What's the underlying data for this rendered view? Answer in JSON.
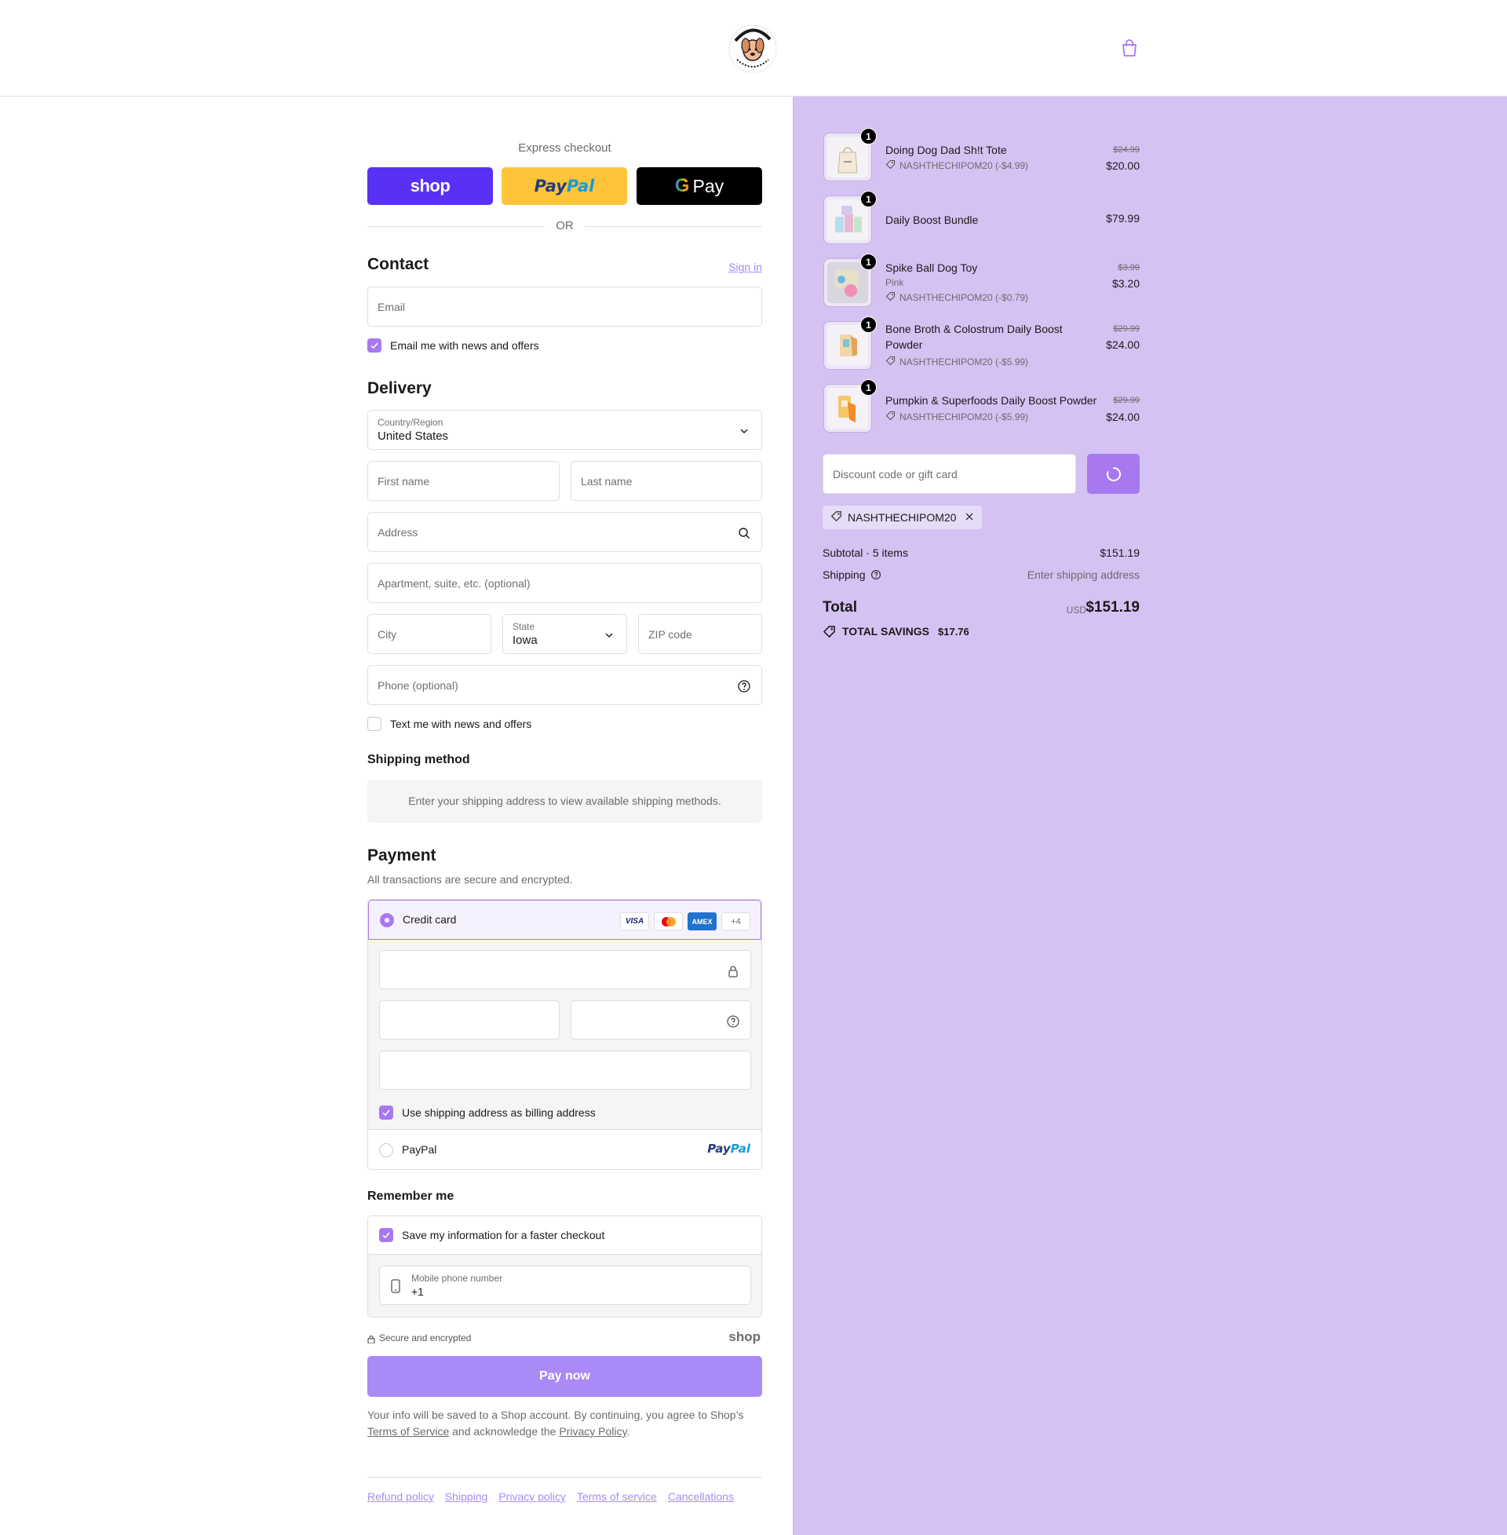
{
  "header": {
    "logo_text_top": "Bundle of Joy",
    "logo_text_bottom": "FAMILY WITH A PURPOSE",
    "cart_icon": "shopping-bag-icon"
  },
  "express": {
    "label": "Express checkout",
    "shop_label": "shop",
    "paypal_label_1": "Pay",
    "paypal_label_2": "Pal",
    "gpay_label": "Pay",
    "or_label": "OR"
  },
  "contact": {
    "title": "Contact",
    "sign_in": "Sign in",
    "email_placeholder": "Email",
    "news_label": "Email me with news and offers"
  },
  "delivery": {
    "title": "Delivery",
    "country_label": "Country/Region",
    "country_value": "United States",
    "first_name_placeholder": "First name",
    "last_name_placeholder": "Last name",
    "address_placeholder": "Address",
    "apartment_placeholder": "Apartment, suite, etc. (optional)",
    "city_placeholder": "City",
    "state_label": "State",
    "state_value": "Iowa",
    "zip_placeholder": "ZIP code",
    "phone_placeholder": "Phone (optional)",
    "text_label": "Text me with news and offers"
  },
  "shipping_method": {
    "title": "Shipping method",
    "message": "Enter your shipping address to view available shipping methods."
  },
  "payment": {
    "title": "Payment",
    "subtitle": "All transactions are secure and encrypted.",
    "credit_card_label": "Credit card",
    "card_brands": [
      "VISA",
      "mastercard",
      "AMEX",
      "+4"
    ],
    "billing_label": "Use shipping address as billing address",
    "paypal_label": "PayPal",
    "paypal_logo_1": "Pay",
    "paypal_logo_2": "Pal"
  },
  "remember": {
    "title": "Remember me",
    "save_label": "Save my information for a faster checkout",
    "phone_label": "Mobile phone number",
    "phone_value": "+1",
    "secure_label": "Secure and encrypted",
    "shop_logo": "shop"
  },
  "pay_now": "Pay now",
  "legal": {
    "text_1": "Your info will be saved to a Shop account. By continuing, you agree to Shop’s",
    "terms": "Terms of Service",
    "text_2": "and acknowledge the",
    "privacy": "Privacy Policy",
    "text_3": "."
  },
  "footer_links": [
    "Refund policy",
    "Shipping",
    "Privacy policy",
    "Terms of service",
    "Cancellations"
  ],
  "summary": {
    "items": [
      {
        "qty": "1",
        "name": "Doing Dog Dad Sh!t Tote",
        "variant": "",
        "discount": "NASHTHECHIPOM20 (-$4.99)",
        "old_price": "$24.99",
        "price": "$20.00"
      },
      {
        "qty": "1",
        "name": "Daily Boost Bundle",
        "variant": "",
        "discount": "",
        "old_price": "",
        "price": "$79.99"
      },
      {
        "qty": "1",
        "name": "Spike Ball Dog Toy",
        "variant": "Pink",
        "discount": "NASHTHECHIPOM20 (-$0.79)",
        "old_price": "$3.99",
        "price": "$3.20"
      },
      {
        "qty": "1",
        "name": "Bone Broth & Colostrum Daily Boost Powder",
        "variant": "",
        "discount": "NASHTHECHIPOM20 (-$5.99)",
        "old_price": "$29.99",
        "price": "$24.00"
      },
      {
        "qty": "1",
        "name": "Pumpkin & Superfoods Daily Boost Powder",
        "variant": "",
        "discount": "NASHTHECHIPOM20 (-$5.99)",
        "old_price": "$29.99",
        "price": "$24.00"
      }
    ],
    "discount_placeholder": "Discount code or gift card",
    "applied_code": "NASHTHECHIPOM20",
    "subtotal_label": "Subtotal · 5 items",
    "subtotal_value": "$151.19",
    "shipping_label": "Shipping",
    "shipping_value": "Enter shipping address",
    "total_label": "Total",
    "currency": "USD",
    "total_value": "$151.19",
    "savings_label": "TOTAL SAVINGS",
    "savings_value": "$17.76"
  },
  "colors": {
    "accent": "#a878f0",
    "summary_bg": "#d4c2f3",
    "shop_purple": "#5a31f4",
    "paypal_yellow": "#ffc439"
  }
}
